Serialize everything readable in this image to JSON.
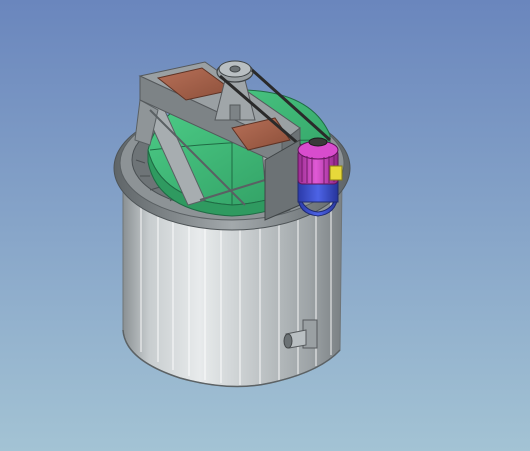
{
  "scene": {
    "subject": "tank-with-belt-driven-agitator",
    "colors": {
      "bg_top": "#6a86bd",
      "bg_bottom": "#a3c3d4",
      "tank_light": "#e6eaec",
      "tank_mid": "#b9bfc2",
      "tank_dark": "#7f8588",
      "rim": "#8b9194",
      "rim_dark": "#5f6568",
      "lid_green": "#3fbf79",
      "lid_green_dark": "#2d8f5b",
      "plate_red": "#a4614a",
      "frame_grey": "#9aa0a3",
      "motor_magenta": "#c33bb7",
      "motor_blue": "#3b4fd0",
      "terminal_yellow": "#e7d93a",
      "belt": "#2a2a2a"
    }
  }
}
